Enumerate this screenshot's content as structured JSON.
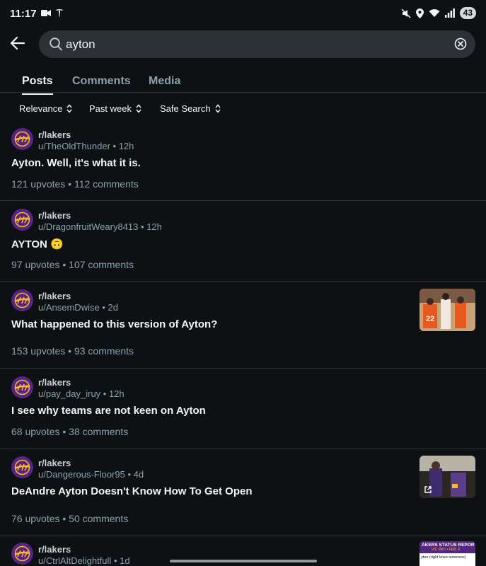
{
  "status": {
    "time": "11:17",
    "battery": "43"
  },
  "search": {
    "query": "ayton"
  },
  "tabs": [
    {
      "label": "Posts",
      "active": true
    },
    {
      "label": "Comments",
      "active": false
    },
    {
      "label": "Media",
      "active": false
    }
  ],
  "filters": [
    {
      "label": "Relevance"
    },
    {
      "label": "Past week"
    },
    {
      "label": "Safe Search"
    }
  ],
  "posts": [
    {
      "subreddit": "r/lakers",
      "user": "u/TheOldThunder",
      "age": "12h",
      "title": "Ayton. Well, it's what it is.",
      "stats": "121 upvotes • 112 comments"
    },
    {
      "subreddit": "r/lakers",
      "user": "u/DragonfruitWeary8413",
      "age": "12h",
      "title": "AYTON 🙃",
      "stats": "97 upvotes • 107 comments"
    },
    {
      "subreddit": "r/lakers",
      "user": "u/AnsemDwise",
      "age": "2d",
      "title": "What happened to this version of Ayton?",
      "stats": "153 upvotes • 93 comments",
      "thumb_number": "22"
    },
    {
      "subreddit": "r/lakers",
      "user": "u/pay_day_iruy",
      "age": "12h",
      "title": "I see why teams are not keen on Ayton",
      "stats": "68 upvotes • 38 comments"
    },
    {
      "subreddit": "r/lakers",
      "user": "u/Dangerous-Floor95",
      "age": "4d",
      "title": "DeAndre Ayton Doesn't Know How To Get Open",
      "stats": "76 upvotes • 50 comments"
    },
    {
      "subreddit": "r/lakers",
      "user": "u/CtrlAltDelightfull",
      "age": "1d",
      "title": "",
      "stats": "",
      "thumb_header": "AKERS STATUS REPOR",
      "thumb_sub": "VS. OKC • FEB. 9",
      "thumb_line": "yton (right knee soreness)"
    }
  ],
  "colors": {
    "background": "#0e1113",
    "lakers_purple": "#552583",
    "lakers_gold": "#fdb927",
    "muted": "#8ba2ad"
  }
}
